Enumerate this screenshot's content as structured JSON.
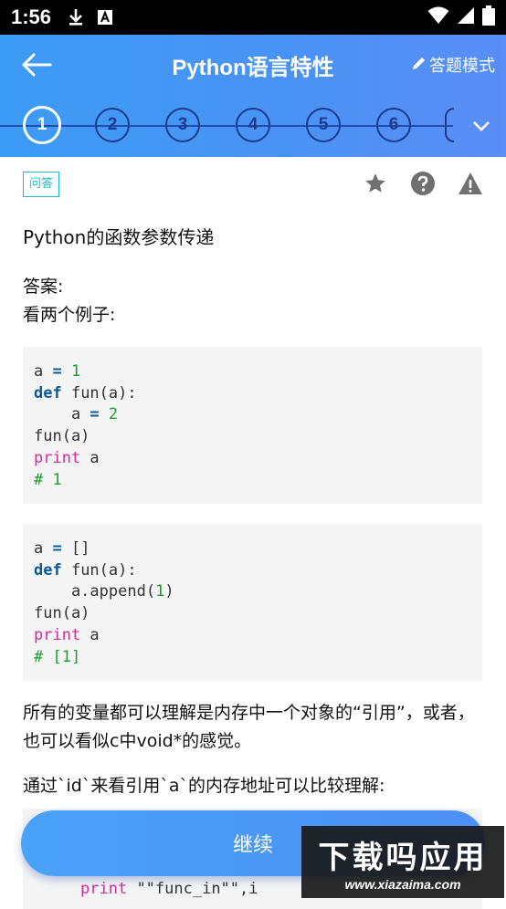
{
  "status_bar": {
    "time": "1:56"
  },
  "app_bar": {
    "title": "Python语言特性",
    "mode_label": "答题模式"
  },
  "progress": {
    "steps": [
      "1",
      "2",
      "3",
      "4",
      "5",
      "6"
    ],
    "current": "1"
  },
  "question": {
    "tag": "问答",
    "title": "Python的函数参数传递",
    "answer_label": "答案:",
    "answer_intro": "看两个例子:",
    "code_block_1": [
      {
        "t": "a "
      },
      {
        "t": "=",
        "c": "op"
      },
      {
        "t": " "
      },
      {
        "t": "1",
        "c": "num"
      },
      {
        "t": "\n"
      },
      {
        "t": "def",
        "c": "kw"
      },
      {
        "t": " fun(a):\n    a "
      },
      {
        "t": "=",
        "c": "op"
      },
      {
        "t": " "
      },
      {
        "t": "2",
        "c": "num"
      },
      {
        "t": "\n"
      },
      {
        "t": "fun(a)\n"
      },
      {
        "t": "print",
        "c": "pr"
      },
      {
        "t": " a\n"
      },
      {
        "t": "# 1",
        "c": "cm"
      }
    ],
    "code_block_2": [
      {
        "t": "a "
      },
      {
        "t": "=",
        "c": "op"
      },
      {
        "t": " []\n"
      },
      {
        "t": "def",
        "c": "kw"
      },
      {
        "t": " fun(a):\n    a.append("
      },
      {
        "t": "1",
        "c": "num"
      },
      {
        "t": ")\n"
      },
      {
        "t": "fun(a)\n"
      },
      {
        "t": "print",
        "c": "pr"
      },
      {
        "t": " a\n"
      },
      {
        "t": "# [1]",
        "c": "cm"
      }
    ],
    "paragraph_1": "所有的变量都可以理解是内存中一个对象的“引用”，或者，也可以看似c中void*的感觉。",
    "paragraph_2": "通过`id`来看引用`a`的内存地址可以比较理解:",
    "code_block_3_partial": "print \"\"func_in\"\",i"
  },
  "continue_button": "继续",
  "watermark": {
    "line1": "下载吗应用",
    "line2": "www.xiazaima.com"
  }
}
